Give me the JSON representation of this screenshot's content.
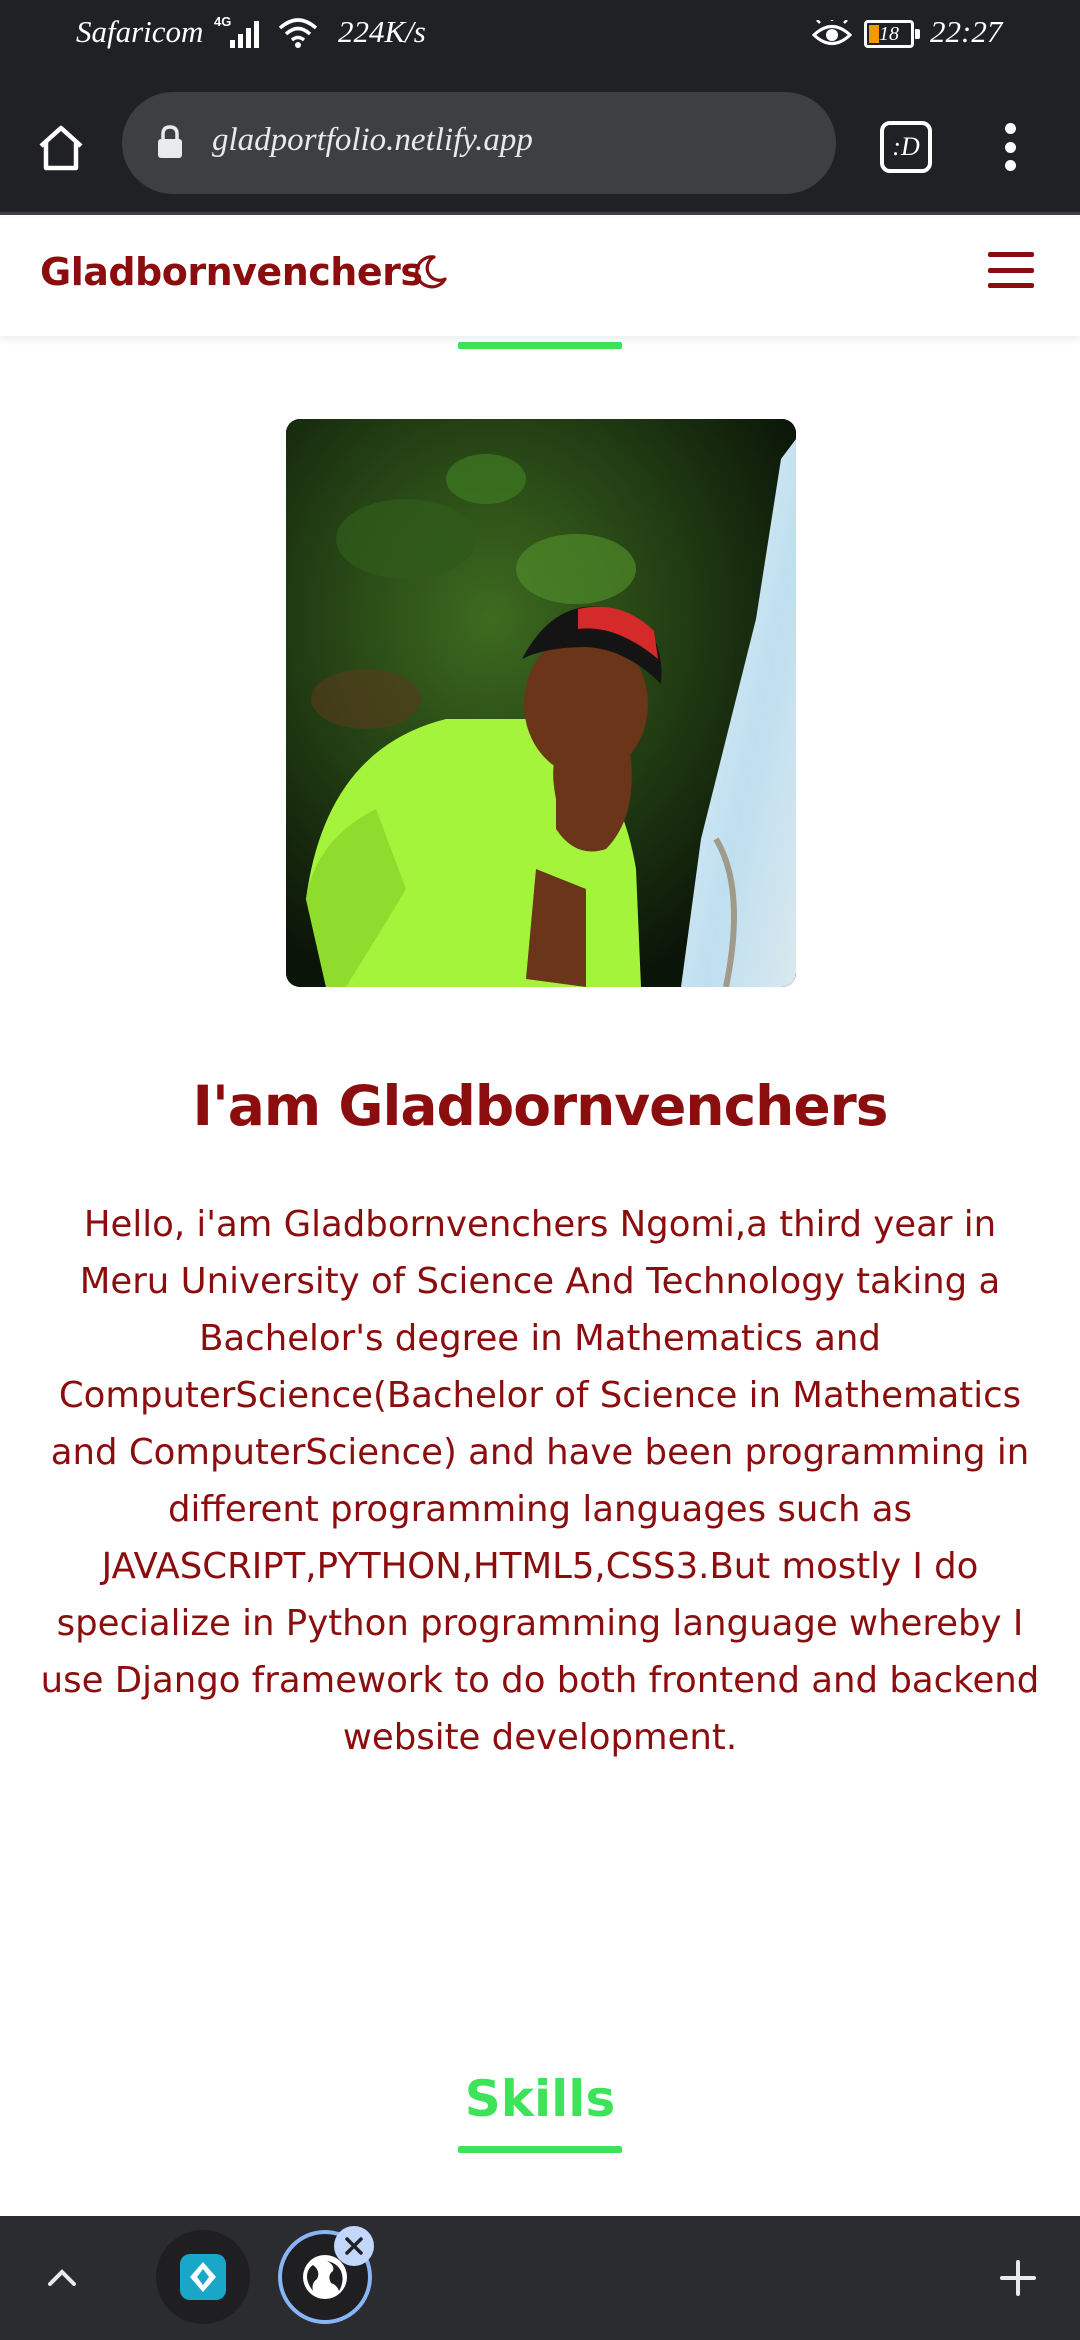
{
  "status_bar": {
    "carrier": "Safaricom",
    "network_type": "4G",
    "speed": "224K/s",
    "battery_level": "18",
    "time": "22:27"
  },
  "browser": {
    "url": "gladportfolio.netlify.app",
    "extension_label": ":D",
    "icons": [
      "home-icon",
      "lock-icon",
      "extension-icon",
      "more-vert-icon"
    ]
  },
  "site": {
    "logo": "Gladbornvenchers",
    "theme_toggle_icon": "moon-icon",
    "menu_icon": "hamburger-icon",
    "brand_color": "#8b0d0d",
    "accent_color": "#3ee35a"
  },
  "hero": {
    "photo_alt": "profile-photo",
    "title": "I'am Gladbornvenchers",
    "bio": "Hello, i'am Gladbornvenchers Ngomi,a third year in Meru University of Science And Technology taking a Bachelor's degree in Mathematics and ComputerScience(Bachelor of Science in Mathematics and ComputerScience) and have been programming in different programming languages such as JAVASCRIPT,PYTHON,HTML5,CSS3.But mostly I do specialize in Python programming language whereby I use Django framework to do both frontend and backend website development."
  },
  "skills": {
    "heading": "Skills"
  },
  "tab_strip": {
    "icons": [
      "chevron-up-icon",
      "tab-favicon",
      "globe-icon",
      "close-icon",
      "plus-icon"
    ],
    "tab_count": 2
  }
}
